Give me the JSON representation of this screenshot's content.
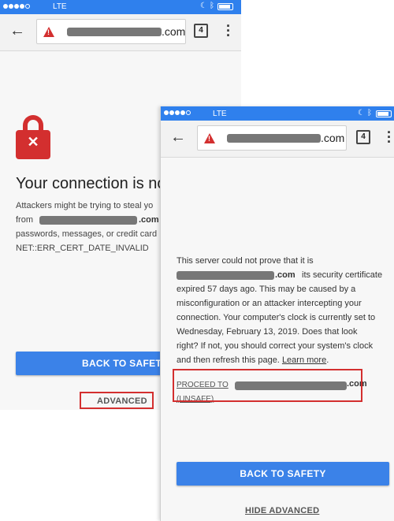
{
  "back_screen": {
    "status": {
      "carrier": "LTE"
    },
    "url": {
      "domain_suffix": ".com",
      "tab_count": "4"
    },
    "title": "Your connection is not",
    "body_line1": "Attackers might be trying to steal yo",
    "body_from": "from",
    "body_domain_suffix": ".com",
    "body_line3": "passwords, messages, or credit card",
    "error_code": "NET::ERR_CERT_DATE_INVALID",
    "back_to_safety_label": "BACK TO SAFETY",
    "advanced_label": "ADVANCED",
    "icons": {
      "lock": "lock-error-icon",
      "back": "arrow-left-icon",
      "warning": "warning-icon",
      "menu": "more-vert-icon"
    }
  },
  "front_screen": {
    "status": {
      "carrier": "LTE"
    },
    "url": {
      "domain_suffix": ".com",
      "tab_count": "4"
    },
    "line1": "This server could not prove that it is",
    "line2_suffix": ".com",
    "line2_rest": "its security certificate",
    "line3": "expired 57 days ago. This may be caused by a",
    "line4": "misconfiguration or an attacker intercepting your",
    "line5": "connection. Your computer's clock is currently set to",
    "line6": "Wednesday, February 13, 2019. Does that look",
    "line7": "right? If not, you should correct your system's clock",
    "line8_prefix": "and then refresh this page.",
    "learn_more": "Learn more",
    "line8_suffix": ".",
    "proceed_prefix": "PROCEED TO",
    "proceed_suffix": ".com",
    "proceed_unsafe": "(UNSAFE)",
    "back_to_safety_label": "BACK TO SAFETY",
    "hide_advanced_label": "HIDE ADVANCED"
  },
  "colors": {
    "status_bar": "#2f80ed",
    "accent_blue": "#3b82e8",
    "error_red": "#d32f2f"
  }
}
